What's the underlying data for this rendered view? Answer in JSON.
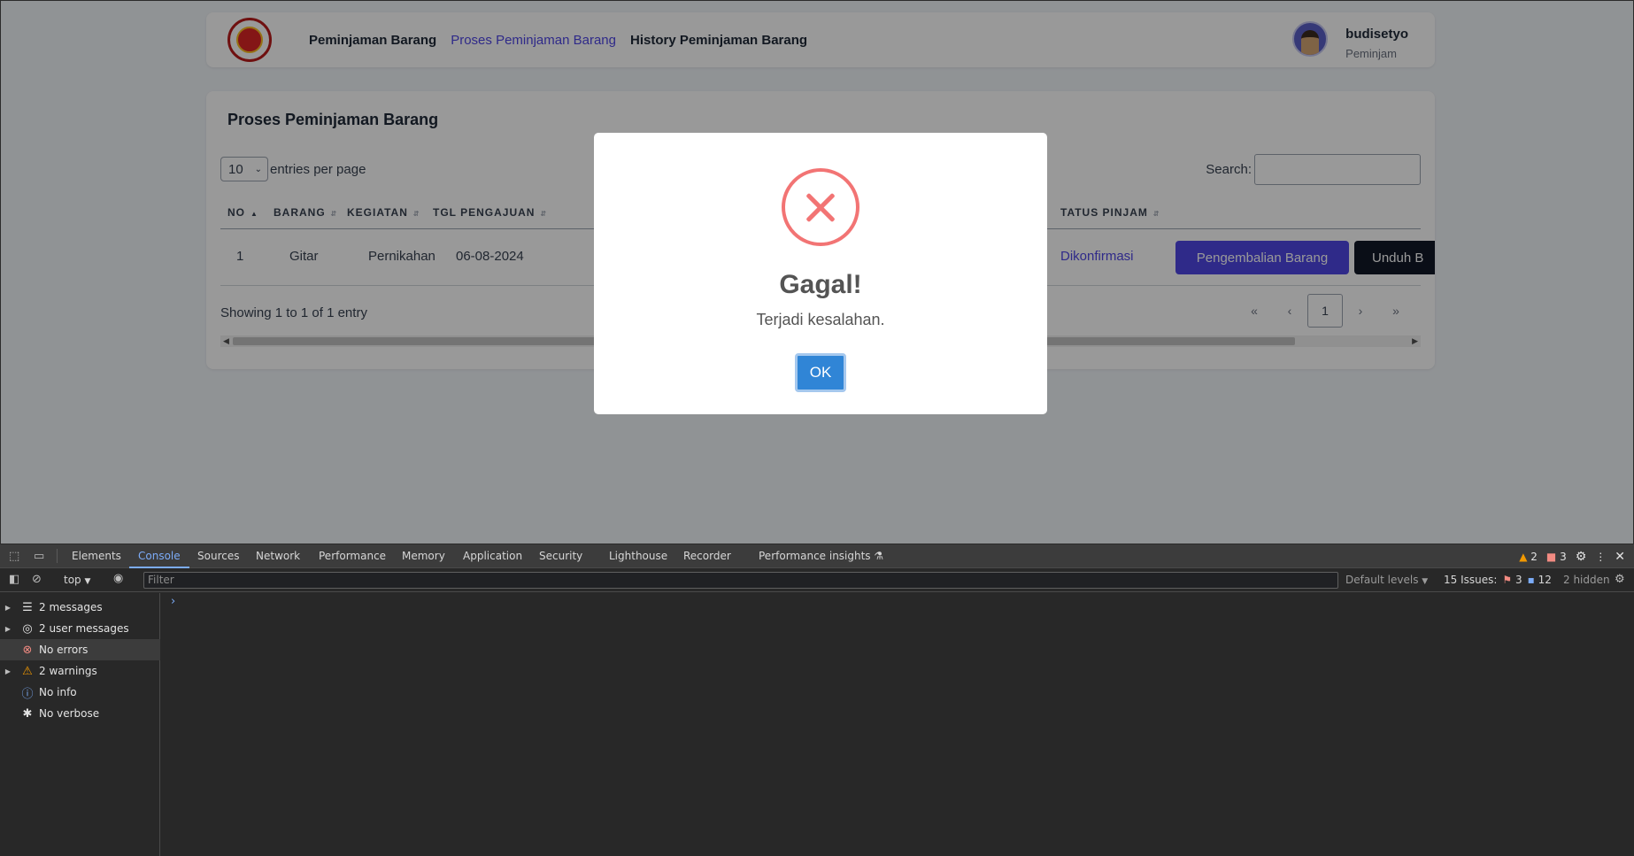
{
  "navbar": {
    "links": [
      "Peminjaman Barang",
      "Proses Peminjaman Barang",
      "History Peminjaman Barang"
    ],
    "user_name": "budisetyo",
    "user_role": "Peminjam"
  },
  "card": {
    "title": "Proses Peminjaman Barang",
    "per_page_value": "10",
    "per_page_label": "entries per page",
    "search_label": "Search:",
    "columns": [
      "NO",
      "BARANG",
      "KEGIATAN",
      "TGL PENGAJUAN",
      "TATUS PINJAM"
    ],
    "row": {
      "no": "1",
      "barang": "Gitar",
      "kegiatan": "Pernikahan",
      "tgl": "06-08-2024",
      "status": "Dikonfirmasi",
      "btn_return": "Pengembalian Barang",
      "btn_download": "Unduh B"
    },
    "showing": "Showing 1 to 1 of 1 entry",
    "pagination": [
      "«",
      "‹",
      "1",
      "›",
      "»"
    ]
  },
  "modal": {
    "title": "Gagal!",
    "text": "Terjadi kesalahan.",
    "ok": "OK"
  },
  "devtools": {
    "tabs": [
      "Elements",
      "Console",
      "Sources",
      "Network",
      "Performance",
      "Memory",
      "Application",
      "Security",
      "Lighthouse",
      "Recorder",
      "Performance insights"
    ],
    "warn_count": "2",
    "error_count": "3",
    "context": "top",
    "filter_placeholder": "Filter",
    "levels": "Default levels",
    "issues_label": "15 Issues:",
    "issues_errors": "3",
    "issues_info": "12",
    "hidden": "2 hidden",
    "sidebar": [
      "2 messages",
      "2 user messages",
      "No errors",
      "2 warnings",
      "No info",
      "No verbose"
    ]
  }
}
